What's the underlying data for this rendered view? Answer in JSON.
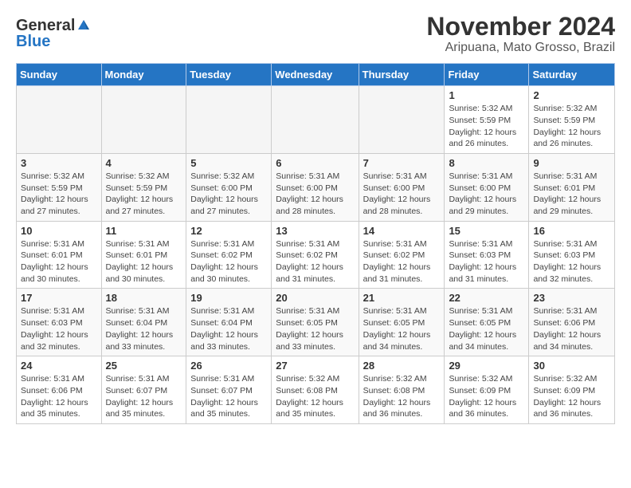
{
  "header": {
    "logo_general": "General",
    "logo_blue": "Blue",
    "title": "November 2024",
    "subtitle": "Aripuana, Mato Grosso, Brazil"
  },
  "days_of_week": [
    "Sunday",
    "Monday",
    "Tuesday",
    "Wednesday",
    "Thursday",
    "Friday",
    "Saturday"
  ],
  "weeks": [
    [
      {
        "day": "",
        "info": ""
      },
      {
        "day": "",
        "info": ""
      },
      {
        "day": "",
        "info": ""
      },
      {
        "day": "",
        "info": ""
      },
      {
        "day": "",
        "info": ""
      },
      {
        "day": "1",
        "info": "Sunrise: 5:32 AM\nSunset: 5:59 PM\nDaylight: 12 hours and 26 minutes."
      },
      {
        "day": "2",
        "info": "Sunrise: 5:32 AM\nSunset: 5:59 PM\nDaylight: 12 hours and 26 minutes."
      }
    ],
    [
      {
        "day": "3",
        "info": "Sunrise: 5:32 AM\nSunset: 5:59 PM\nDaylight: 12 hours and 27 minutes."
      },
      {
        "day": "4",
        "info": "Sunrise: 5:32 AM\nSunset: 5:59 PM\nDaylight: 12 hours and 27 minutes."
      },
      {
        "day": "5",
        "info": "Sunrise: 5:32 AM\nSunset: 6:00 PM\nDaylight: 12 hours and 27 minutes."
      },
      {
        "day": "6",
        "info": "Sunrise: 5:31 AM\nSunset: 6:00 PM\nDaylight: 12 hours and 28 minutes."
      },
      {
        "day": "7",
        "info": "Sunrise: 5:31 AM\nSunset: 6:00 PM\nDaylight: 12 hours and 28 minutes."
      },
      {
        "day": "8",
        "info": "Sunrise: 5:31 AM\nSunset: 6:00 PM\nDaylight: 12 hours and 29 minutes."
      },
      {
        "day": "9",
        "info": "Sunrise: 5:31 AM\nSunset: 6:01 PM\nDaylight: 12 hours and 29 minutes."
      }
    ],
    [
      {
        "day": "10",
        "info": "Sunrise: 5:31 AM\nSunset: 6:01 PM\nDaylight: 12 hours and 30 minutes."
      },
      {
        "day": "11",
        "info": "Sunrise: 5:31 AM\nSunset: 6:01 PM\nDaylight: 12 hours and 30 minutes."
      },
      {
        "day": "12",
        "info": "Sunrise: 5:31 AM\nSunset: 6:02 PM\nDaylight: 12 hours and 30 minutes."
      },
      {
        "day": "13",
        "info": "Sunrise: 5:31 AM\nSunset: 6:02 PM\nDaylight: 12 hours and 31 minutes."
      },
      {
        "day": "14",
        "info": "Sunrise: 5:31 AM\nSunset: 6:02 PM\nDaylight: 12 hours and 31 minutes."
      },
      {
        "day": "15",
        "info": "Sunrise: 5:31 AM\nSunset: 6:03 PM\nDaylight: 12 hours and 31 minutes."
      },
      {
        "day": "16",
        "info": "Sunrise: 5:31 AM\nSunset: 6:03 PM\nDaylight: 12 hours and 32 minutes."
      }
    ],
    [
      {
        "day": "17",
        "info": "Sunrise: 5:31 AM\nSunset: 6:03 PM\nDaylight: 12 hours and 32 minutes."
      },
      {
        "day": "18",
        "info": "Sunrise: 5:31 AM\nSunset: 6:04 PM\nDaylight: 12 hours and 33 minutes."
      },
      {
        "day": "19",
        "info": "Sunrise: 5:31 AM\nSunset: 6:04 PM\nDaylight: 12 hours and 33 minutes."
      },
      {
        "day": "20",
        "info": "Sunrise: 5:31 AM\nSunset: 6:05 PM\nDaylight: 12 hours and 33 minutes."
      },
      {
        "day": "21",
        "info": "Sunrise: 5:31 AM\nSunset: 6:05 PM\nDaylight: 12 hours and 34 minutes."
      },
      {
        "day": "22",
        "info": "Sunrise: 5:31 AM\nSunset: 6:05 PM\nDaylight: 12 hours and 34 minutes."
      },
      {
        "day": "23",
        "info": "Sunrise: 5:31 AM\nSunset: 6:06 PM\nDaylight: 12 hours and 34 minutes."
      }
    ],
    [
      {
        "day": "24",
        "info": "Sunrise: 5:31 AM\nSunset: 6:06 PM\nDaylight: 12 hours and 35 minutes."
      },
      {
        "day": "25",
        "info": "Sunrise: 5:31 AM\nSunset: 6:07 PM\nDaylight: 12 hours and 35 minutes."
      },
      {
        "day": "26",
        "info": "Sunrise: 5:31 AM\nSunset: 6:07 PM\nDaylight: 12 hours and 35 minutes."
      },
      {
        "day": "27",
        "info": "Sunrise: 5:32 AM\nSunset: 6:08 PM\nDaylight: 12 hours and 35 minutes."
      },
      {
        "day": "28",
        "info": "Sunrise: 5:32 AM\nSunset: 6:08 PM\nDaylight: 12 hours and 36 minutes."
      },
      {
        "day": "29",
        "info": "Sunrise: 5:32 AM\nSunset: 6:09 PM\nDaylight: 12 hours and 36 minutes."
      },
      {
        "day": "30",
        "info": "Sunrise: 5:32 AM\nSunset: 6:09 PM\nDaylight: 12 hours and 36 minutes."
      }
    ]
  ]
}
